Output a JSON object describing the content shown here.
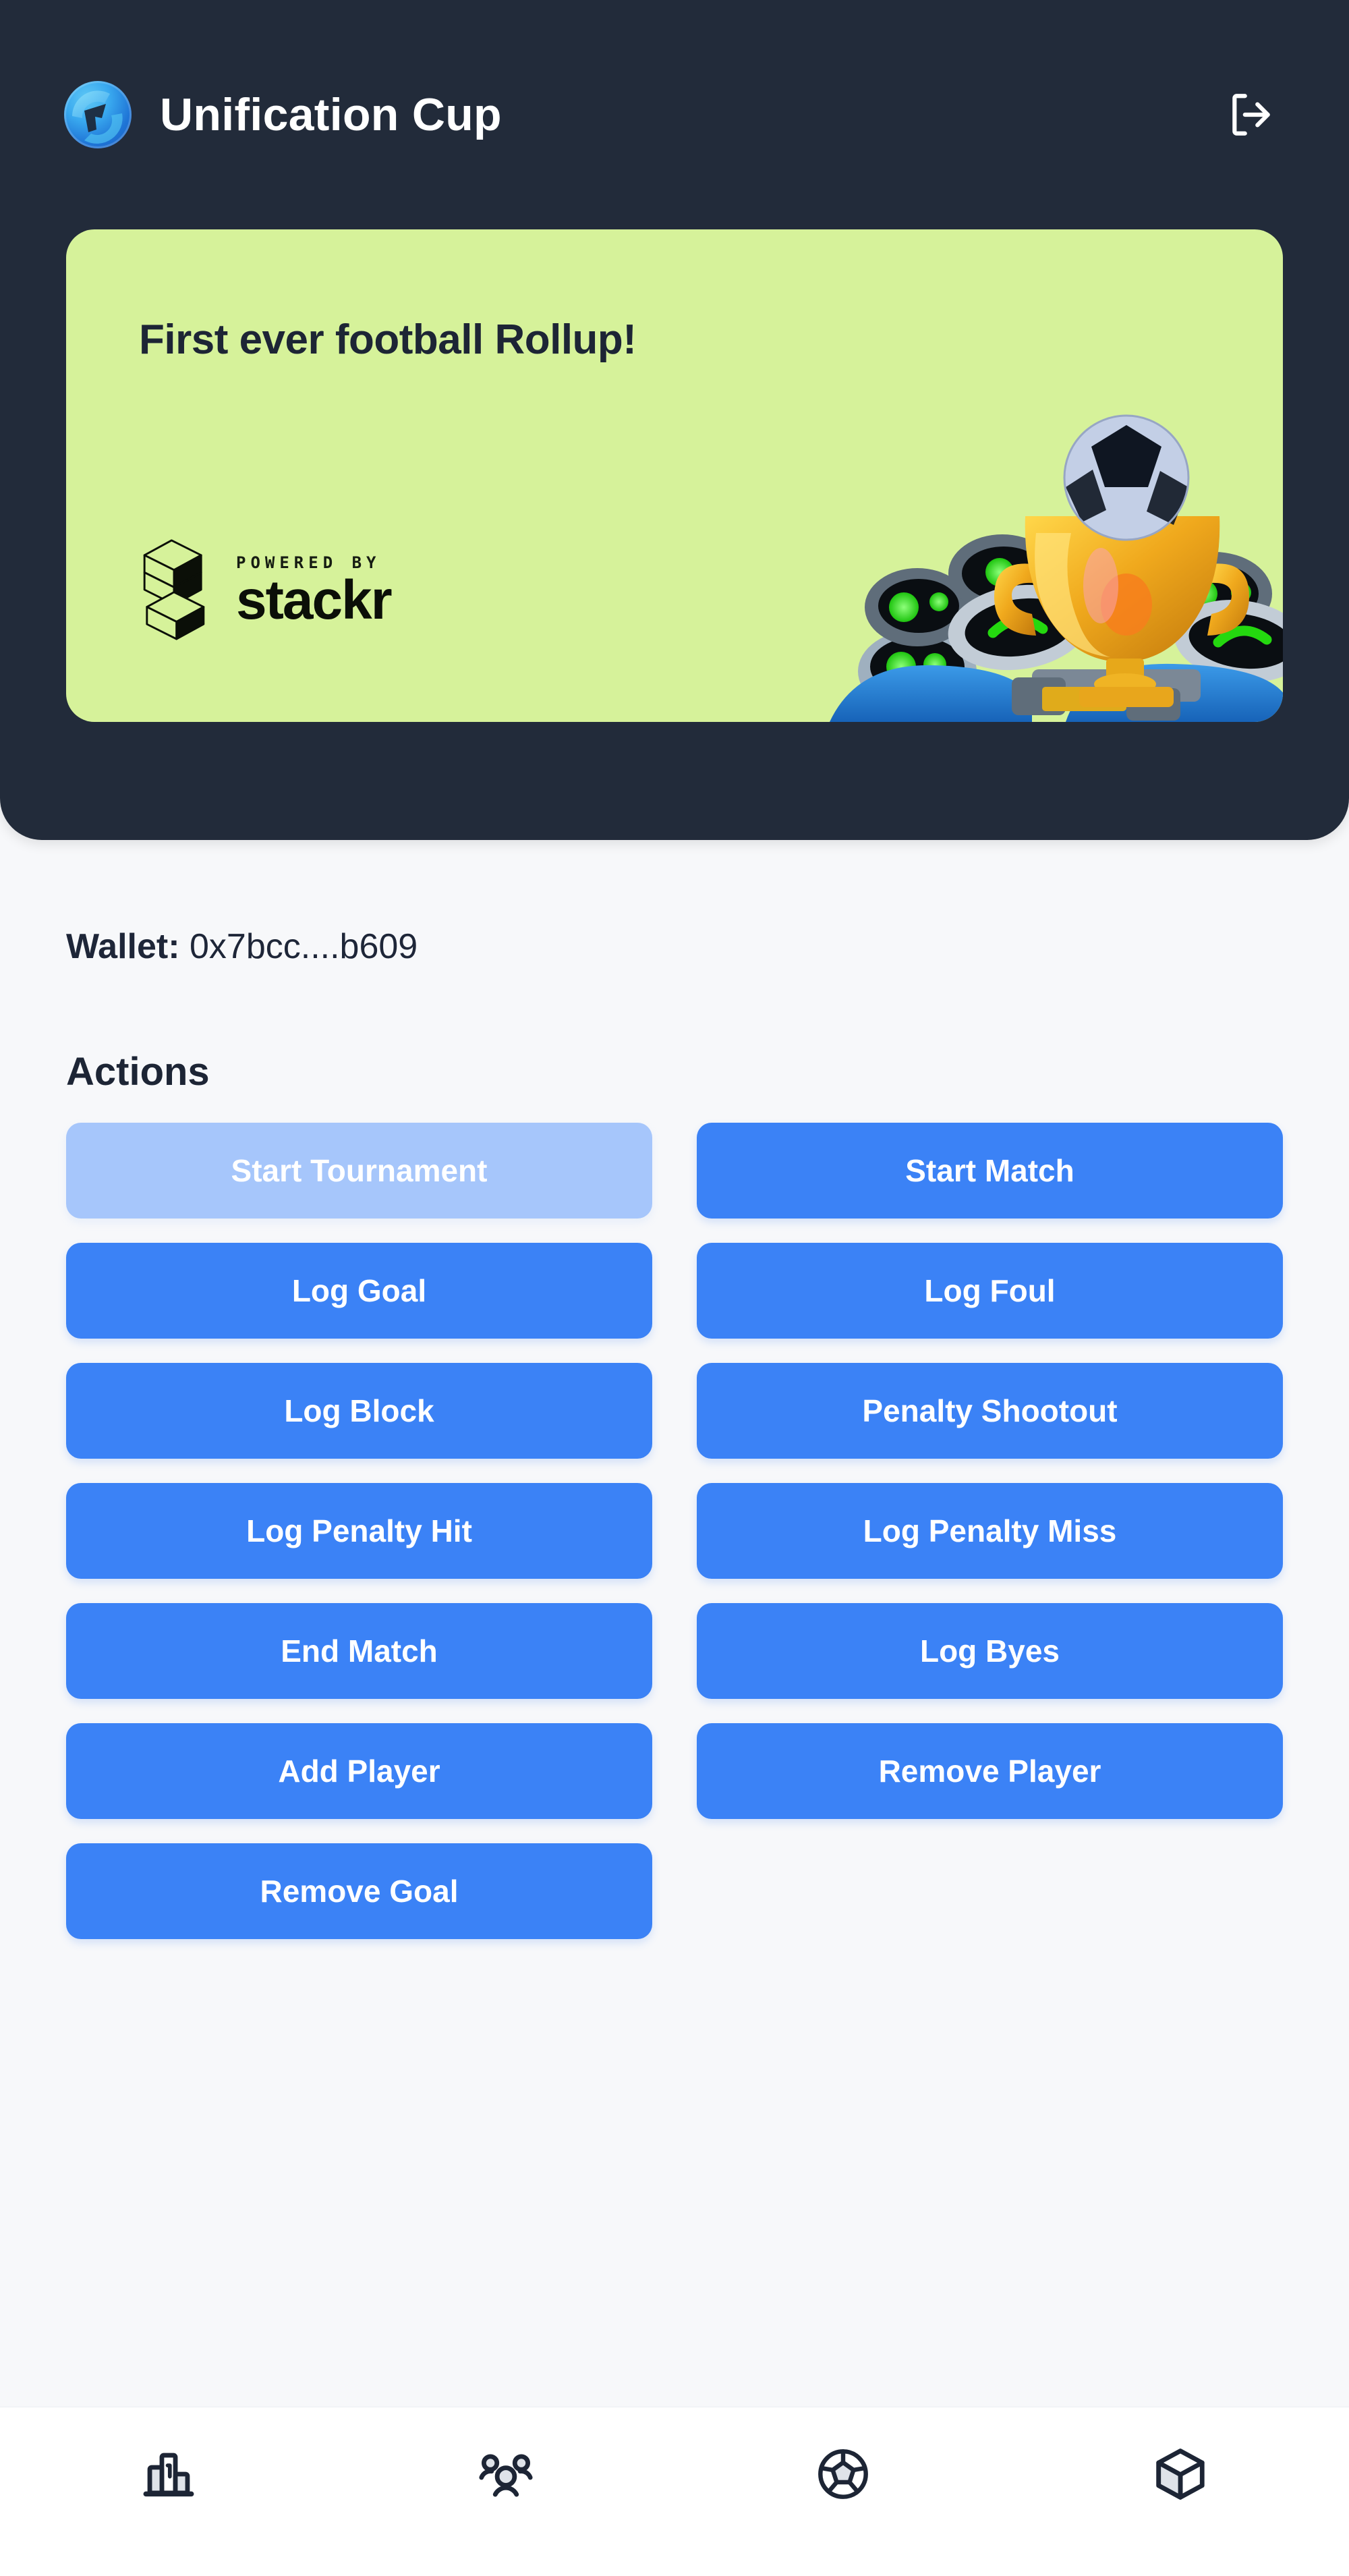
{
  "header": {
    "app_title": "Unification Cup",
    "logo_icon": "globe-swoosh-logo",
    "logout_icon": "logout-icon"
  },
  "banner": {
    "headline": "First ever football Rollup!",
    "powered_by_label": "POWERED BY",
    "brand_name": "stackr",
    "brand_mark_icon": "stackr-isometric-s-icon",
    "artwork_icon": "trophy-robots-illustration",
    "background_color": "#d6f29a",
    "text_color": "#1d2535"
  },
  "wallet": {
    "label": "Wallet:",
    "address": "0x7bcc....b609"
  },
  "actions": {
    "title": "Actions",
    "primary_color": "#3b82f6",
    "disabled_color": "#a6c6fb",
    "items": [
      {
        "label": "Start Tournament",
        "state": "disabled"
      },
      {
        "label": "Start Match",
        "state": "enabled"
      },
      {
        "label": "Log Goal",
        "state": "enabled"
      },
      {
        "label": "Log Foul",
        "state": "enabled"
      },
      {
        "label": "Log Block",
        "state": "enabled"
      },
      {
        "label": "Penalty Shootout",
        "state": "enabled"
      },
      {
        "label": "Log Penalty Hit",
        "state": "enabled"
      },
      {
        "label": "Log Penalty Miss",
        "state": "enabled"
      },
      {
        "label": "End Match",
        "state": "enabled"
      },
      {
        "label": "Log Byes",
        "state": "enabled"
      },
      {
        "label": "Add Player",
        "state": "enabled"
      },
      {
        "label": "Remove Player",
        "state": "enabled"
      },
      {
        "label": "Remove Goal",
        "state": "enabled"
      }
    ]
  },
  "bottom_nav": {
    "items": [
      {
        "icon": "leaderboard-podium-icon"
      },
      {
        "icon": "users-group-icon"
      },
      {
        "icon": "soccer-ball-icon"
      },
      {
        "icon": "cube-block-icon"
      }
    ]
  }
}
